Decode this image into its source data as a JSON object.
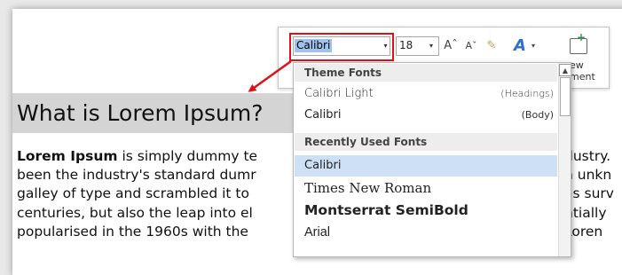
{
  "document": {
    "heading": "What is Lorem Ipsum?",
    "lines": [
      {
        "bold": "Lorem Ipsum",
        "left": " is simply dummy te",
        "right": "dustry."
      },
      {
        "left": "been the industry's standard dumr",
        "right": "n unkn"
      },
      {
        "left": "galley of type and scrambled it to",
        "right": "as surv"
      },
      {
        "left": "centuries, but also the leap into el",
        "right": "ntially"
      },
      {
        "left": "popularised in the 1960s with the",
        "right": "Loren"
      }
    ]
  },
  "toolbar": {
    "font_name": "Calibri",
    "font_size": "18",
    "grow_font": "Aˆ",
    "shrink_font": "Aˇ",
    "comment_label_1": "ew",
    "comment_label_2": "ment"
  },
  "font_dropdown": {
    "theme_header": "Theme Fonts",
    "theme_fonts": [
      {
        "name": "Calibri Light",
        "tag": "(Headings)"
      },
      {
        "name": "Calibri",
        "tag": "(Body)"
      }
    ],
    "recent_header": "Recently Used Fonts",
    "recent_fonts": [
      "Calibri",
      "Times New Roman",
      "Montserrat SemiBold",
      "Arial"
    ]
  },
  "icons": {
    "dropdown_arrow": "▾",
    "scroll_up": "▲"
  },
  "colors": {
    "highlight_box": "#e0101a",
    "selected_item": "#cee0f5",
    "selected_text": "#9ec3ee"
  }
}
